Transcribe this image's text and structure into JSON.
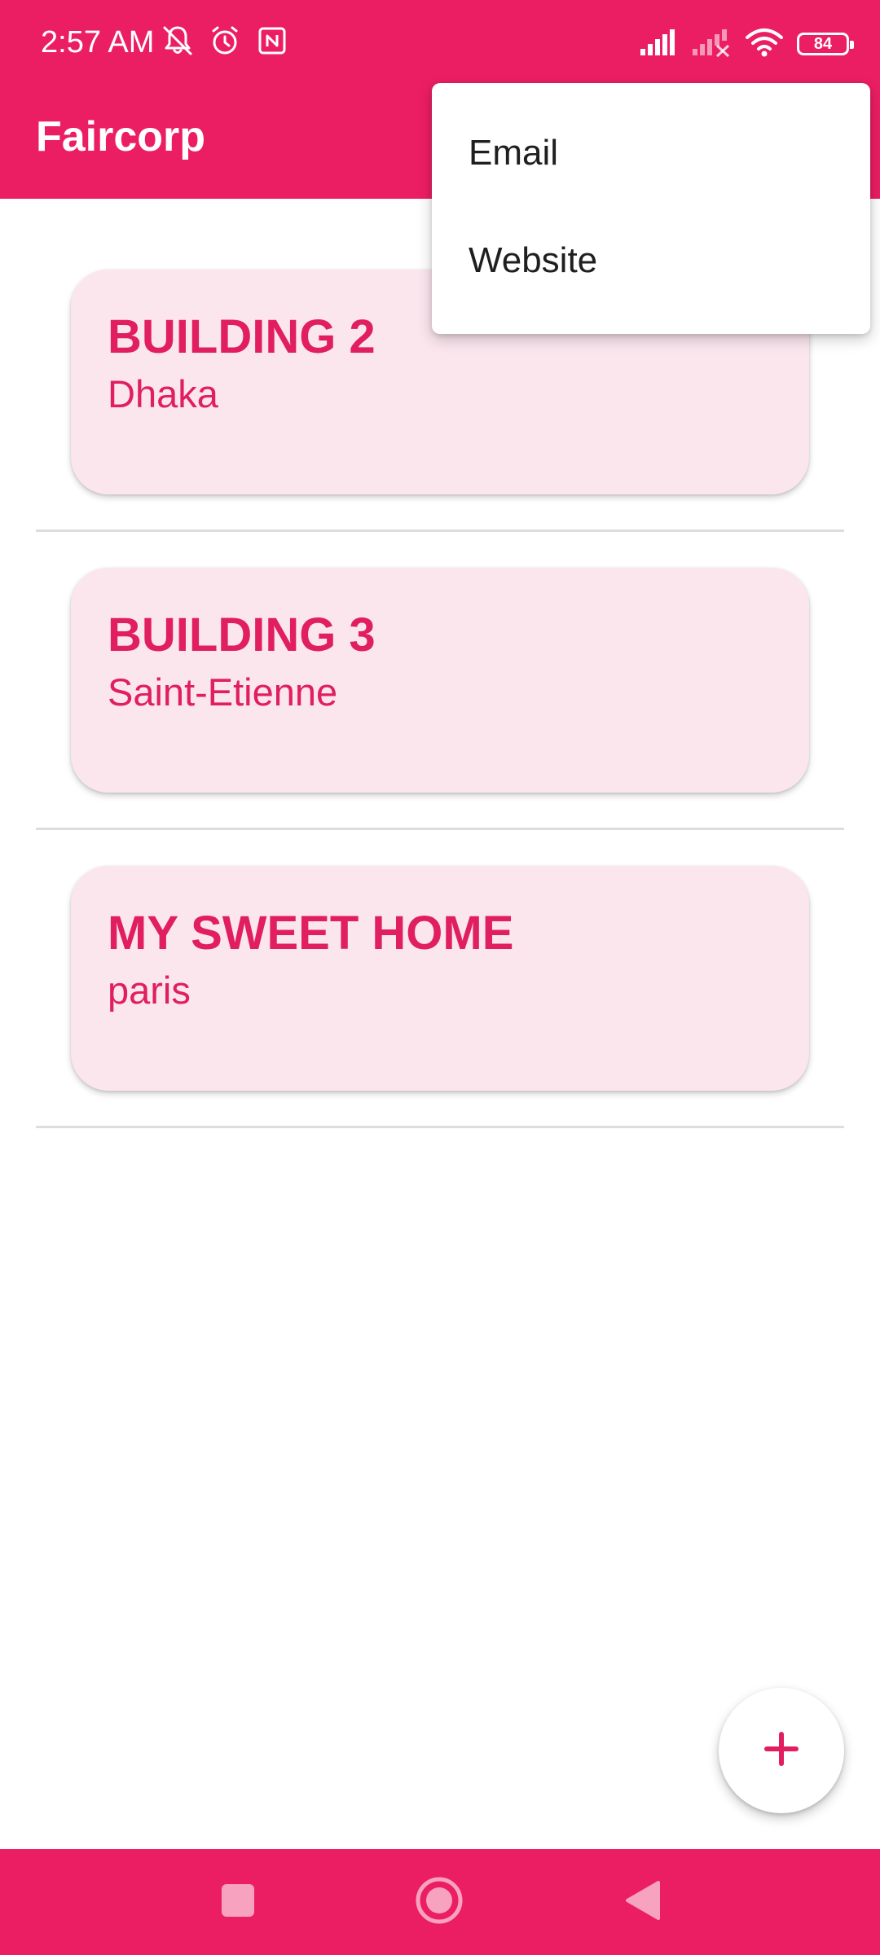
{
  "colors": {
    "primary": "#EC1E63",
    "card_background": "#FBE6EE",
    "card_text": "#E01E60",
    "menu_text": "#1F1F1F",
    "divider": "#DDDDDD"
  },
  "status_bar": {
    "time": "2:57 AM",
    "left_icons": [
      "bell-muted-icon",
      "alarm-icon",
      "nfc-icon"
    ],
    "right_icons": [
      "cell-signal-icon",
      "cell-signal-no-service-icon",
      "wifi-icon",
      "battery-icon"
    ],
    "battery_level": "84"
  },
  "app_bar": {
    "title": "Faircorp"
  },
  "buildings": [
    {
      "name": "BUILDING 2",
      "city": "Dhaka"
    },
    {
      "name": "BUILDING 3",
      "city": "Saint-Etienne"
    },
    {
      "name": "MY SWEET HOME",
      "city": "paris"
    }
  ],
  "overflow_menu": {
    "items": [
      {
        "label": "Email"
      },
      {
        "label": "Website"
      }
    ]
  },
  "fab": {
    "icon": "plus-icon"
  },
  "navigation_bar": {
    "buttons": [
      "recents-square-icon",
      "home-circle-icon",
      "back-triangle-icon"
    ]
  }
}
